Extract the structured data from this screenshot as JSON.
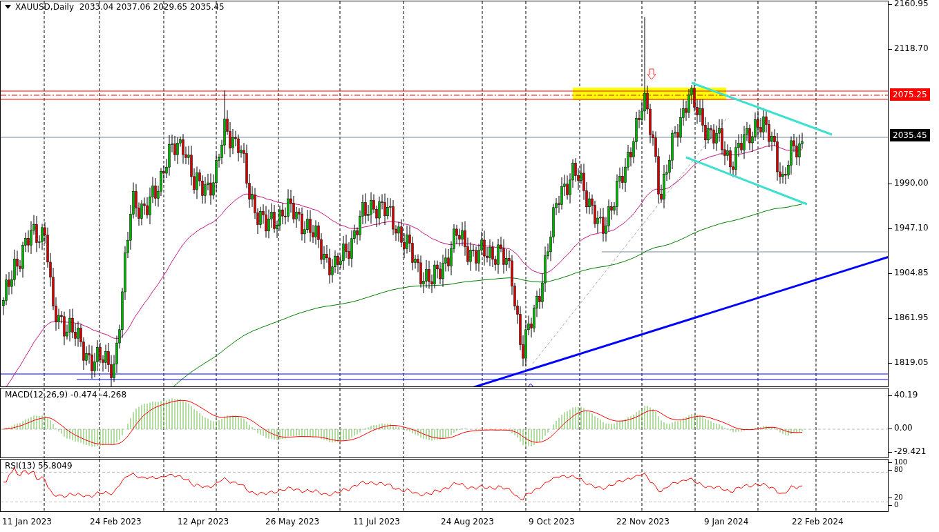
{
  "main_chart": {
    "header": "XAUUSD,Daily  2033.04 2037.06 2029.65 2035.45",
    "price_axis": [
      {
        "text": "2160.95"
      },
      {
        "text": "2118.70"
      },
      {
        "text": "1990.00"
      },
      {
        "text": "1947.10"
      },
      {
        "text": "1904.85"
      },
      {
        "text": "1861.95"
      },
      {
        "text": "1819.05"
      }
    ],
    "price_tags": [
      {
        "text": "2075.25",
        "kind": "alert"
      },
      {
        "text": "2035.45",
        "kind": "bid"
      }
    ]
  },
  "macd": {
    "label": "MACD(12,26,9) -0.474 -4.268",
    "axis": [
      "40.19",
      "0.00",
      "-29.421"
    ]
  },
  "rsi": {
    "label": "RSI(13) 55.8049",
    "axis": [
      "100",
      "80",
      "20",
      "0"
    ]
  },
  "time_axis": [
    "11 Jan 2023",
    "24 Feb 2023",
    "12 Apr 2023",
    "26 May 2023",
    "11 Jul 2023",
    "24 Aug 2023",
    "9 Oct 2023",
    "22 Nov 2023",
    "9 Jan 2024",
    "22 Feb 2024"
  ]
}
